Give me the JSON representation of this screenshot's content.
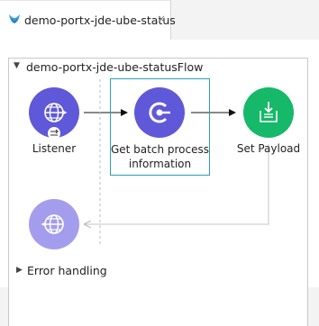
{
  "tab": {
    "title": "demo-portx-jde-ube-status",
    "close_glyph": "×",
    "icon": "mule-icon"
  },
  "flow": {
    "toggle": "▼",
    "name": "demo-portx-jde-ube-statusFlow",
    "components": [
      {
        "label": "Listener",
        "icon": "globe-icon",
        "color": "#5f58d9"
      },
      {
        "label": "Get batch process information",
        "label_line1": "Get batch process",
        "label_line2": "information",
        "icon": "connector-icon",
        "color": "#5f58d9",
        "selected": true
      },
      {
        "label": "Set Payload",
        "icon": "set-payload-icon",
        "color": "#16b86a"
      }
    ],
    "response_icon": "globe-icon"
  },
  "error_handling": {
    "toggle": "▶",
    "label": "Error handling"
  },
  "colors": {
    "accent": "#5f58d9",
    "payload": "#16b86a",
    "selection": "#2d9fb3"
  }
}
